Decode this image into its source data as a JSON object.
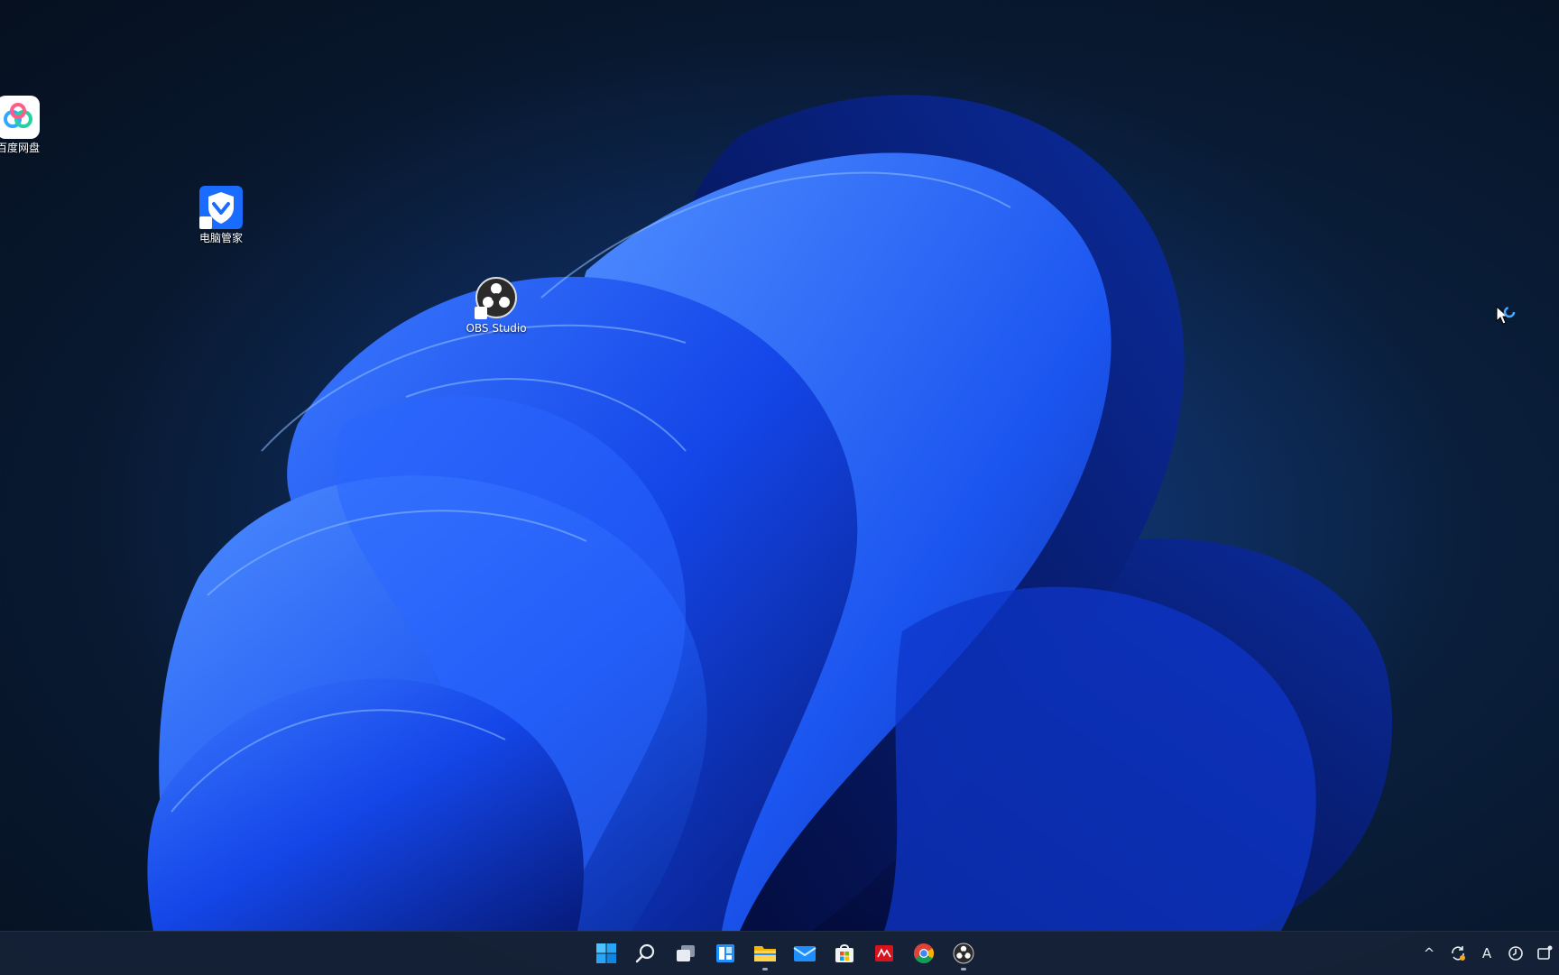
{
  "desktop": {
    "icons": [
      {
        "label": "百度网盘",
        "icon": "baidu-netdisk-icon"
      },
      {
        "label": "电脑管家",
        "icon": "tencent-pc-manager-icon"
      },
      {
        "label": "OBS Studio",
        "icon": "obs-studio-icon"
      }
    ]
  },
  "taskbar": {
    "pinned": [
      {
        "name": "start",
        "icon": "windows-start-icon",
        "running": false
      },
      {
        "name": "search",
        "icon": "search-icon",
        "running": false
      },
      {
        "name": "task-view",
        "icon": "task-view-icon",
        "running": false
      },
      {
        "name": "widgets",
        "icon": "widgets-icon",
        "running": false
      },
      {
        "name": "file-explorer",
        "icon": "file-explorer-icon",
        "running": true
      },
      {
        "name": "mail",
        "icon": "mail-icon",
        "running": false
      },
      {
        "name": "microsoft-store",
        "icon": "store-icon",
        "running": false
      },
      {
        "name": "red-app",
        "icon": "red-app-icon",
        "running": false
      },
      {
        "name": "chrome",
        "icon": "chrome-icon",
        "running": false
      },
      {
        "name": "obs-studio",
        "icon": "obs-studio-icon",
        "running": true
      }
    ],
    "tray": {
      "chevron": "^",
      "ime_label": "A"
    }
  },
  "colors": {
    "accent": "#0a5cff",
    "taskbar": "#162236",
    "desktop_dark": "#06101f"
  }
}
